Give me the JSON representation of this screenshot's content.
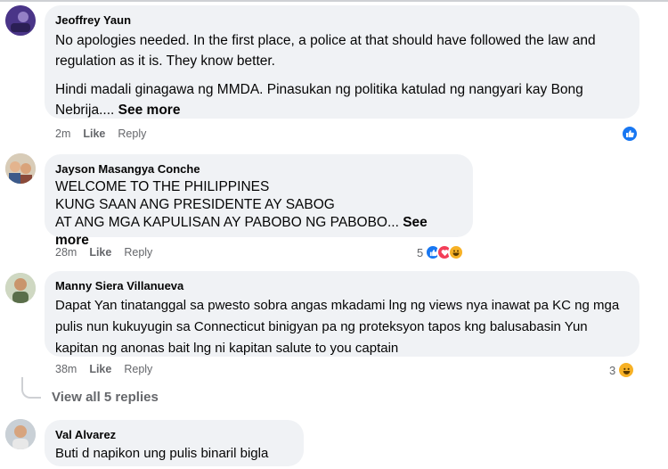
{
  "comments": [
    {
      "author": "Jeoffrey Yaun",
      "paragraphs": [
        "No apologies needed. In the first place, a police at that should have followed the law and regulation as it is. They know better.",
        "Hindi madali ginagawa ng MMDA. Pinasukan ng politika katulad ng nangyari kay Bong Nebrija...."
      ],
      "see_more": "See more",
      "time": "2m",
      "like": "Like",
      "reply": "Reply",
      "reaction_count": ""
    },
    {
      "author": "Jayson Masangya Conche",
      "lines": [
        "WELCOME TO THE PHILIPPINES",
        "KUNG SAAN ANG PRESIDENTE AY SABOG",
        "AT ANG MGA KAPULISAN AY PABOBO NG PABOBO..."
      ],
      "see_more": "See more",
      "time": "28m",
      "like": "Like",
      "reply": "Reply",
      "reaction_count": "5"
    },
    {
      "author": "Manny Siera Villanueva",
      "text": "Dapat Yan tinatanggal sa pwesto sobra angas mkadami lng ng views nya inawat pa KC ng mga pulis nun kukuyugin sa Connecticut binigyan pa ng proteksyon tapos kng balusabasin Yun kapitan ng anonas bait lng ni kapitan salute to you captain",
      "time": "38m",
      "like": "Like",
      "reply": "Reply",
      "reaction_count": "3"
    },
    {
      "author": "Val Alvarez",
      "text": "Buti d napikon ung pulis binaril bigla"
    }
  ],
  "view_replies": "View all 5 replies",
  "colors": {
    "bubble": "#f0f2f5",
    "meta": "#65676b",
    "like_blue": "#1877f2",
    "love_red": "#f33e58",
    "haha_yellow": "#f7b125"
  },
  "icons": [
    "like-reaction-icon",
    "love-reaction-icon",
    "haha-reaction-icon"
  ]
}
